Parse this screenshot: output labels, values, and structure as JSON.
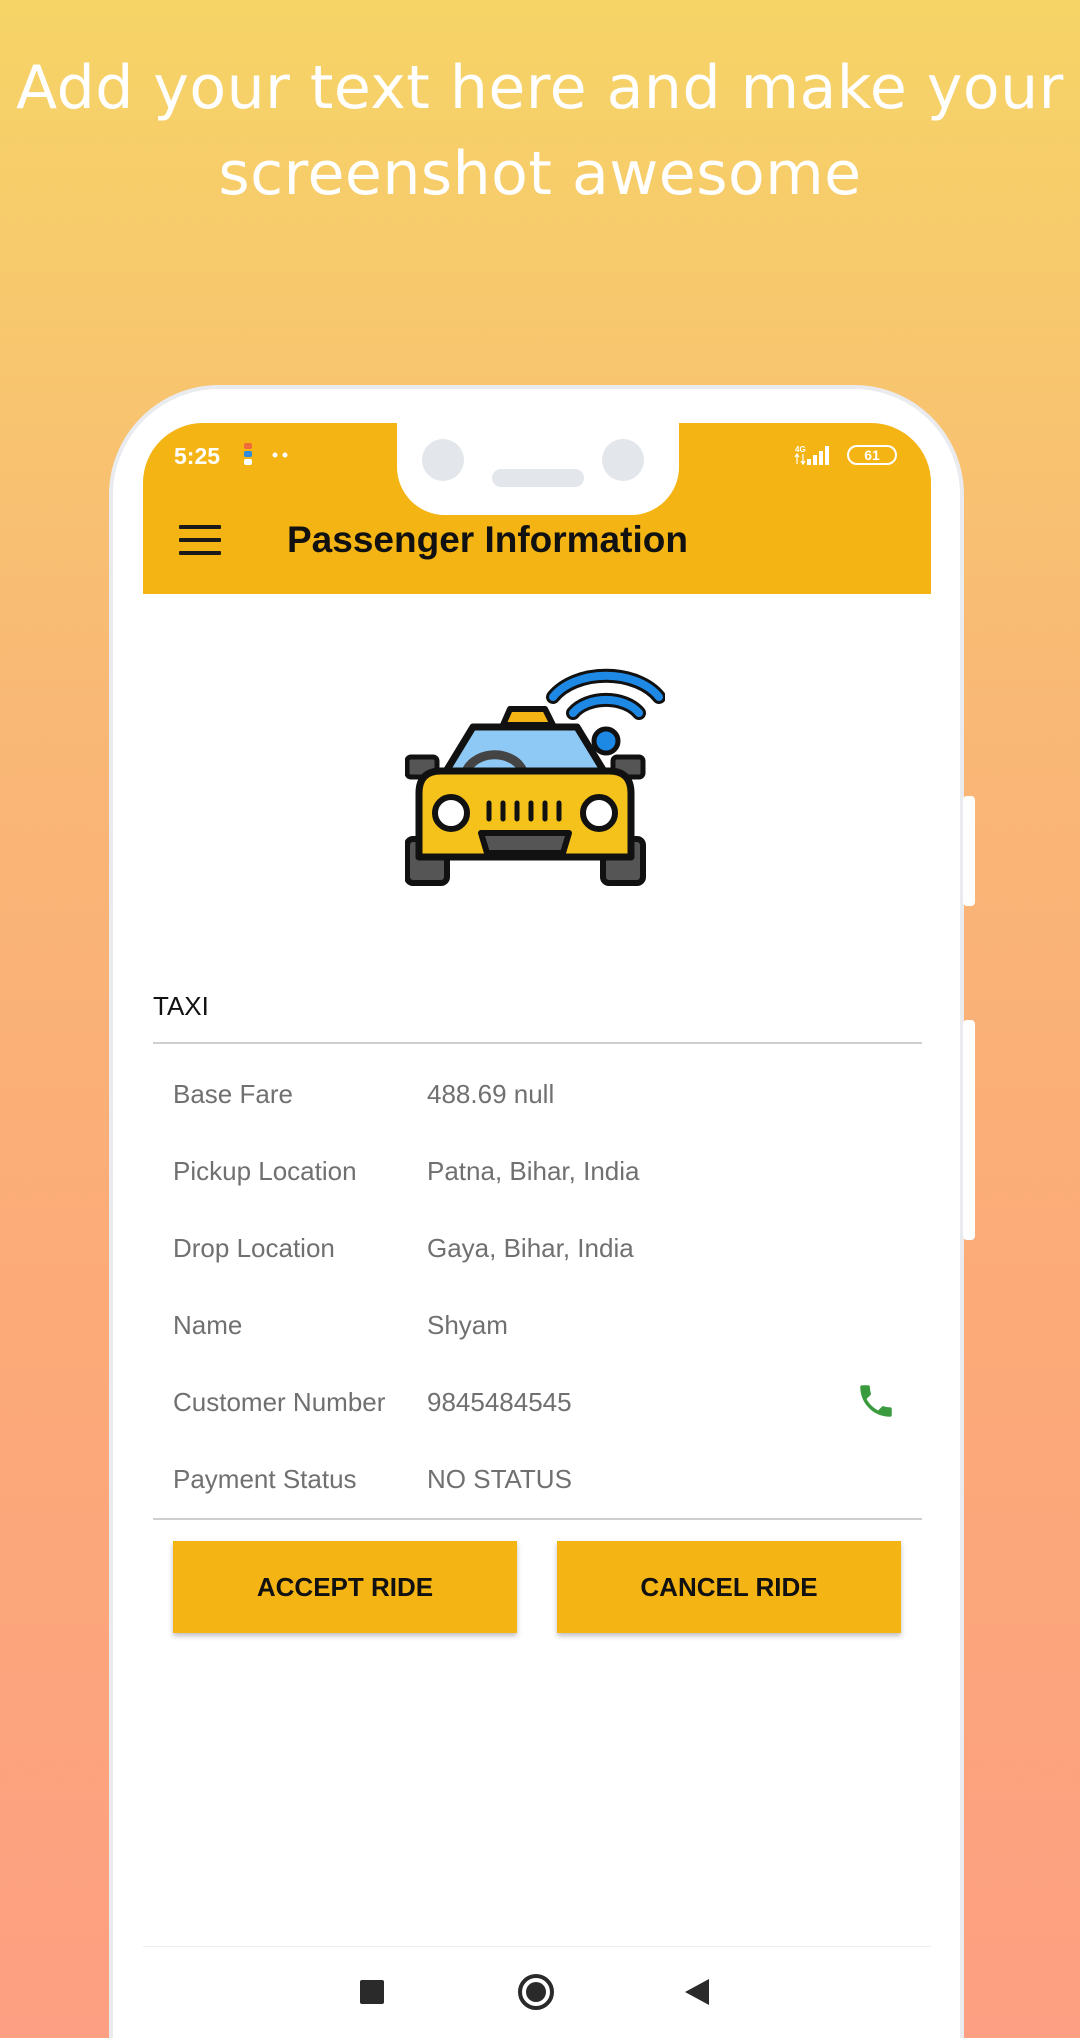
{
  "promo": {
    "headline_line1": "Add your text here and make your",
    "headline_line2": "screenshot awesome"
  },
  "status_bar": {
    "time": "5:25",
    "network": "4G",
    "battery": "61"
  },
  "app_bar": {
    "title": "Passenger Information"
  },
  "vehicle": {
    "type": "TAXI"
  },
  "details": [
    {
      "label": "Base Fare",
      "value": "488.69 null"
    },
    {
      "label": "Pickup Location",
      "value": "Patna, Bihar, India"
    },
    {
      "label": "Drop Location",
      "value": "Gaya, Bihar, India"
    },
    {
      "label": "Name",
      "value": "Shyam"
    },
    {
      "label": "Customer Number",
      "value": "9845484545"
    },
    {
      "label": "Payment Status",
      "value": "NO STATUS"
    }
  ],
  "actions": {
    "accept": "ACCEPT RIDE",
    "cancel": "CANCEL RIDE"
  },
  "colors": {
    "accent": "#f4b413",
    "call": "#3a9a3e",
    "wifi": "#1e88e5"
  }
}
